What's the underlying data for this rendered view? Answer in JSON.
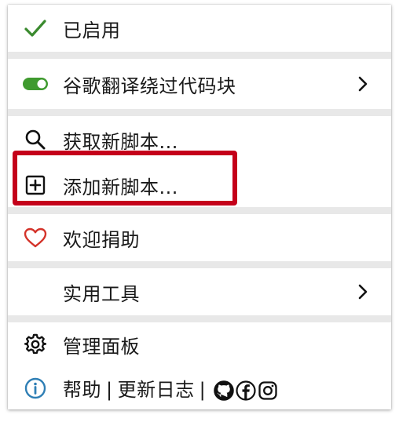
{
  "menu": {
    "enabled": {
      "label": "已启用",
      "icon": "checkmark-icon",
      "color": "#3a8a2e"
    },
    "current_script": {
      "label": "谷歌翻译绕过代码块",
      "icon": "toggle-icon",
      "toggle_color": "#3f9a2f",
      "toggle_on": true
    },
    "get_new": {
      "label": "获取新脚本...",
      "icon": "search-icon"
    },
    "add_new": {
      "label": "添加新脚本...",
      "icon": "plus-square-icon"
    },
    "donate": {
      "label": "欢迎捐助",
      "icon": "heart-icon",
      "color": "#d4332a"
    },
    "utilities": {
      "label": "实用工具"
    },
    "dashboard": {
      "label": "管理面板",
      "icon": "gear-icon"
    },
    "help": {
      "help_label": "帮助",
      "divider": "|",
      "changelog_label": "更新日志",
      "icon": "info-icon",
      "icon_color": "#2f7fb5",
      "social": [
        "github-icon",
        "facebook-icon",
        "instagram-icon"
      ]
    }
  },
  "highlight_color": "#c4001a"
}
